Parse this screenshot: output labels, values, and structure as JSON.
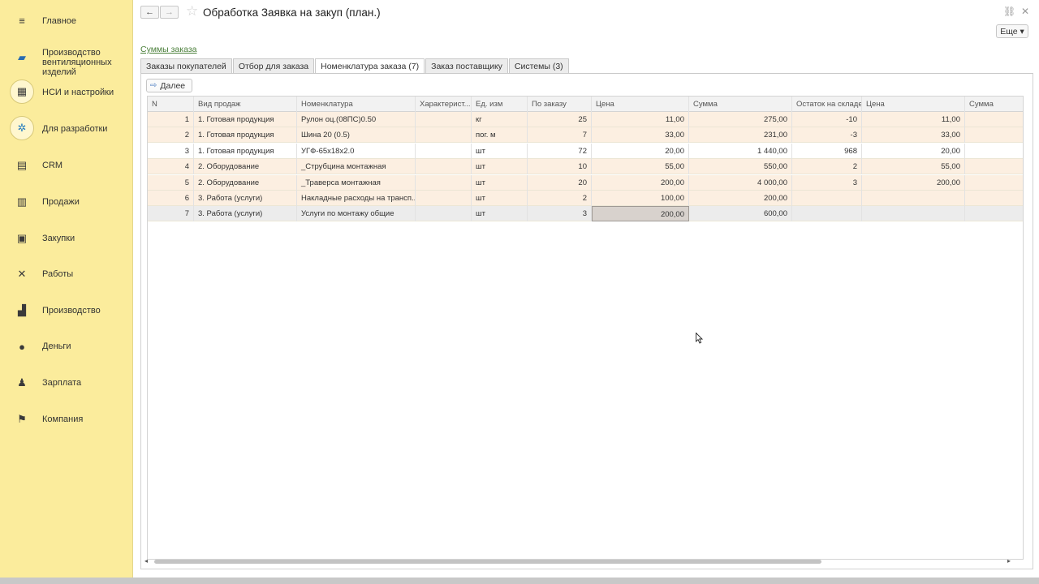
{
  "sidebar": {
    "items": [
      {
        "label": "Главное",
        "icon": "menu-icon"
      },
      {
        "label": "Производство вентиляционных изделий",
        "icon": "workshop-icon"
      },
      {
        "label": "НСИ и настройки",
        "icon": "settings-catalog-icon"
      },
      {
        "label": "Для разработки",
        "icon": "developers-icon"
      },
      {
        "label": "CRM",
        "icon": "crm-icon"
      },
      {
        "label": "Продажи",
        "icon": "sales-icon"
      },
      {
        "label": "Закупки",
        "icon": "cart-icon"
      },
      {
        "label": "Работы",
        "icon": "tools-icon"
      },
      {
        "label": "Производство",
        "icon": "factory-icon"
      },
      {
        "label": "Деньги",
        "icon": "money-icon"
      },
      {
        "label": "Зарплата",
        "icon": "people-icon"
      },
      {
        "label": "Компания",
        "icon": "flag-icon"
      }
    ]
  },
  "header": {
    "back": "←",
    "forward": "→",
    "title": "Обработка Заявка на закуп (план.)",
    "more_label": "Еще ▾"
  },
  "sums_link": "Суммы заказа",
  "tabs": [
    {
      "label": "Заказы покупателей",
      "active": false
    },
    {
      "label": "Отбор для заказа",
      "active": false
    },
    {
      "label": "Номенклатура заказа (7)",
      "active": true
    },
    {
      "label": "Заказ поставщику",
      "active": false
    },
    {
      "label": "Системы (3)",
      "active": false
    }
  ],
  "next_button": "Далее",
  "table": {
    "columns": [
      "N",
      "Вид продаж",
      "Номенклатура",
      "Характерист...",
      "Ед. изм",
      "По заказу",
      "Цена",
      "Сумма",
      "Остаток на складе",
      "Цена",
      "Сумма"
    ],
    "rows": [
      [
        "1",
        "1. Готовая продукция",
        "Рулон оц.(08ПС)0.50",
        "",
        "кг",
        "25",
        "11,00",
        "275,00",
        "-10",
        "11,00",
        ""
      ],
      [
        "2",
        "1. Готовая продукция",
        "Шина 20 (0.5)",
        "",
        "пог. м",
        "7",
        "33,00",
        "231,00",
        "-3",
        "33,00",
        ""
      ],
      [
        "3",
        "1. Готовая продукция",
        "УГФ-65х18х2.0",
        "",
        "шт",
        "72",
        "20,00",
        "1 440,00",
        "968",
        "20,00",
        ""
      ],
      [
        "4",
        "2. Оборудование",
        "_Струбцина монтажная",
        "",
        "шт",
        "10",
        "55,00",
        "550,00",
        "2",
        "55,00",
        ""
      ],
      [
        "5",
        "2. Оборудование",
        "_Траверса монтажная",
        "",
        "шт",
        "20",
        "200,00",
        "4 000,00",
        "3",
        "200,00",
        ""
      ],
      [
        "6",
        "3. Работа (услуги)",
        "Накладные расходы на трансп...",
        "",
        "шт",
        "2",
        "100,00",
        "200,00",
        "",
        "",
        ""
      ],
      [
        "7",
        "3. Работа (услуги)",
        "Услуги по монтажу общие",
        "",
        "шт",
        "3",
        "200,00",
        "600,00",
        "",
        "",
        ""
      ]
    ]
  }
}
